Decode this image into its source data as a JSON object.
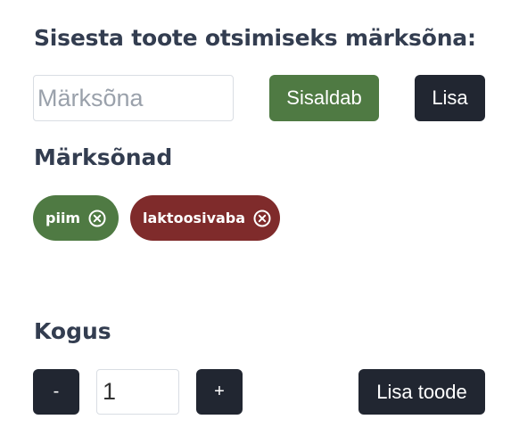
{
  "title": "Sisesta toote otsimiseks märksõna:",
  "search": {
    "placeholder": "Märksõna",
    "value": ""
  },
  "buttons": {
    "contains": "Sisaldab",
    "add": "Lisa",
    "minus": "-",
    "plus": "+",
    "add_product": "Lisa toode"
  },
  "keywords_heading": "Märksõnad",
  "keywords": [
    {
      "label": "piim",
      "color": "#4f7a43",
      "icon": "close-circle-icon"
    },
    {
      "label": "laktoosivaba",
      "color": "#7f2b2b",
      "icon": "close-circle-icon"
    }
  ],
  "quantity_heading": "Kogus",
  "quantity": {
    "value": "1"
  }
}
